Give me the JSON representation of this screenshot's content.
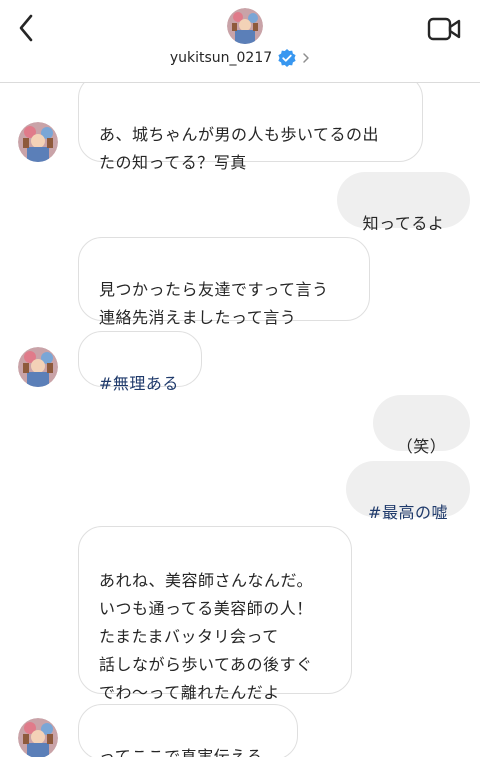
{
  "header": {
    "username": "yukitsun_0217"
  },
  "messages": [
    {
      "text": "あ、城ちゃんが男の人も歩いてるの出\nたの知ってる？写真"
    },
    {
      "text": "知ってるよ"
    },
    {
      "text": "見つかったら友達ですって言う\n連絡先消えましたって言う"
    },
    {
      "text": "#無理ある"
    },
    {
      "text": "（笑）"
    },
    {
      "text": "#最高の嘘"
    },
    {
      "text": "あれね、美容師さんなんだ。\nいつも通ってる美容師の人！\nたまたまバッタリ会って\n話しながら歩いてあの後すぐ\nでわ〜って離れたんだよ"
    },
    {
      "text": "ってここで真実伝える"
    }
  ]
}
